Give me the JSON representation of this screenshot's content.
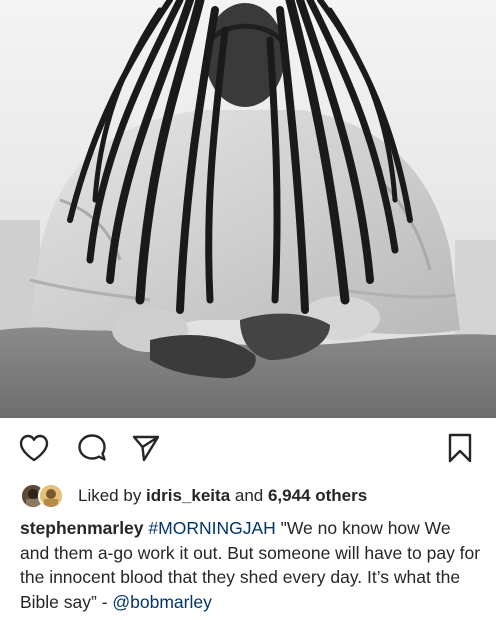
{
  "post": {
    "photo": {
      "alt_name": "black-and-white photo of seated man with long dreadlocks"
    },
    "actions": {
      "like_icon": "heart-icon",
      "comment_icon": "comment-bubble-icon",
      "share_icon": "paper-plane-icon",
      "save_icon": "bookmark-icon"
    },
    "likes": {
      "prefix": "Liked by ",
      "user": "idris_keita",
      "middle": " and ",
      "others": "6,944 others"
    },
    "caption": {
      "username": "stephenmarley",
      "hashtag": "#MORNINGJAH",
      "text": " \"We no know how We and them a-go work it out. But someone will have to pay for the innocent blood that they shed every day. It’s what the Bible say” - ",
      "mention": "@bobmarley"
    }
  },
  "colors": {
    "text": "#262626",
    "link": "#003569",
    "icon": "#262626"
  }
}
